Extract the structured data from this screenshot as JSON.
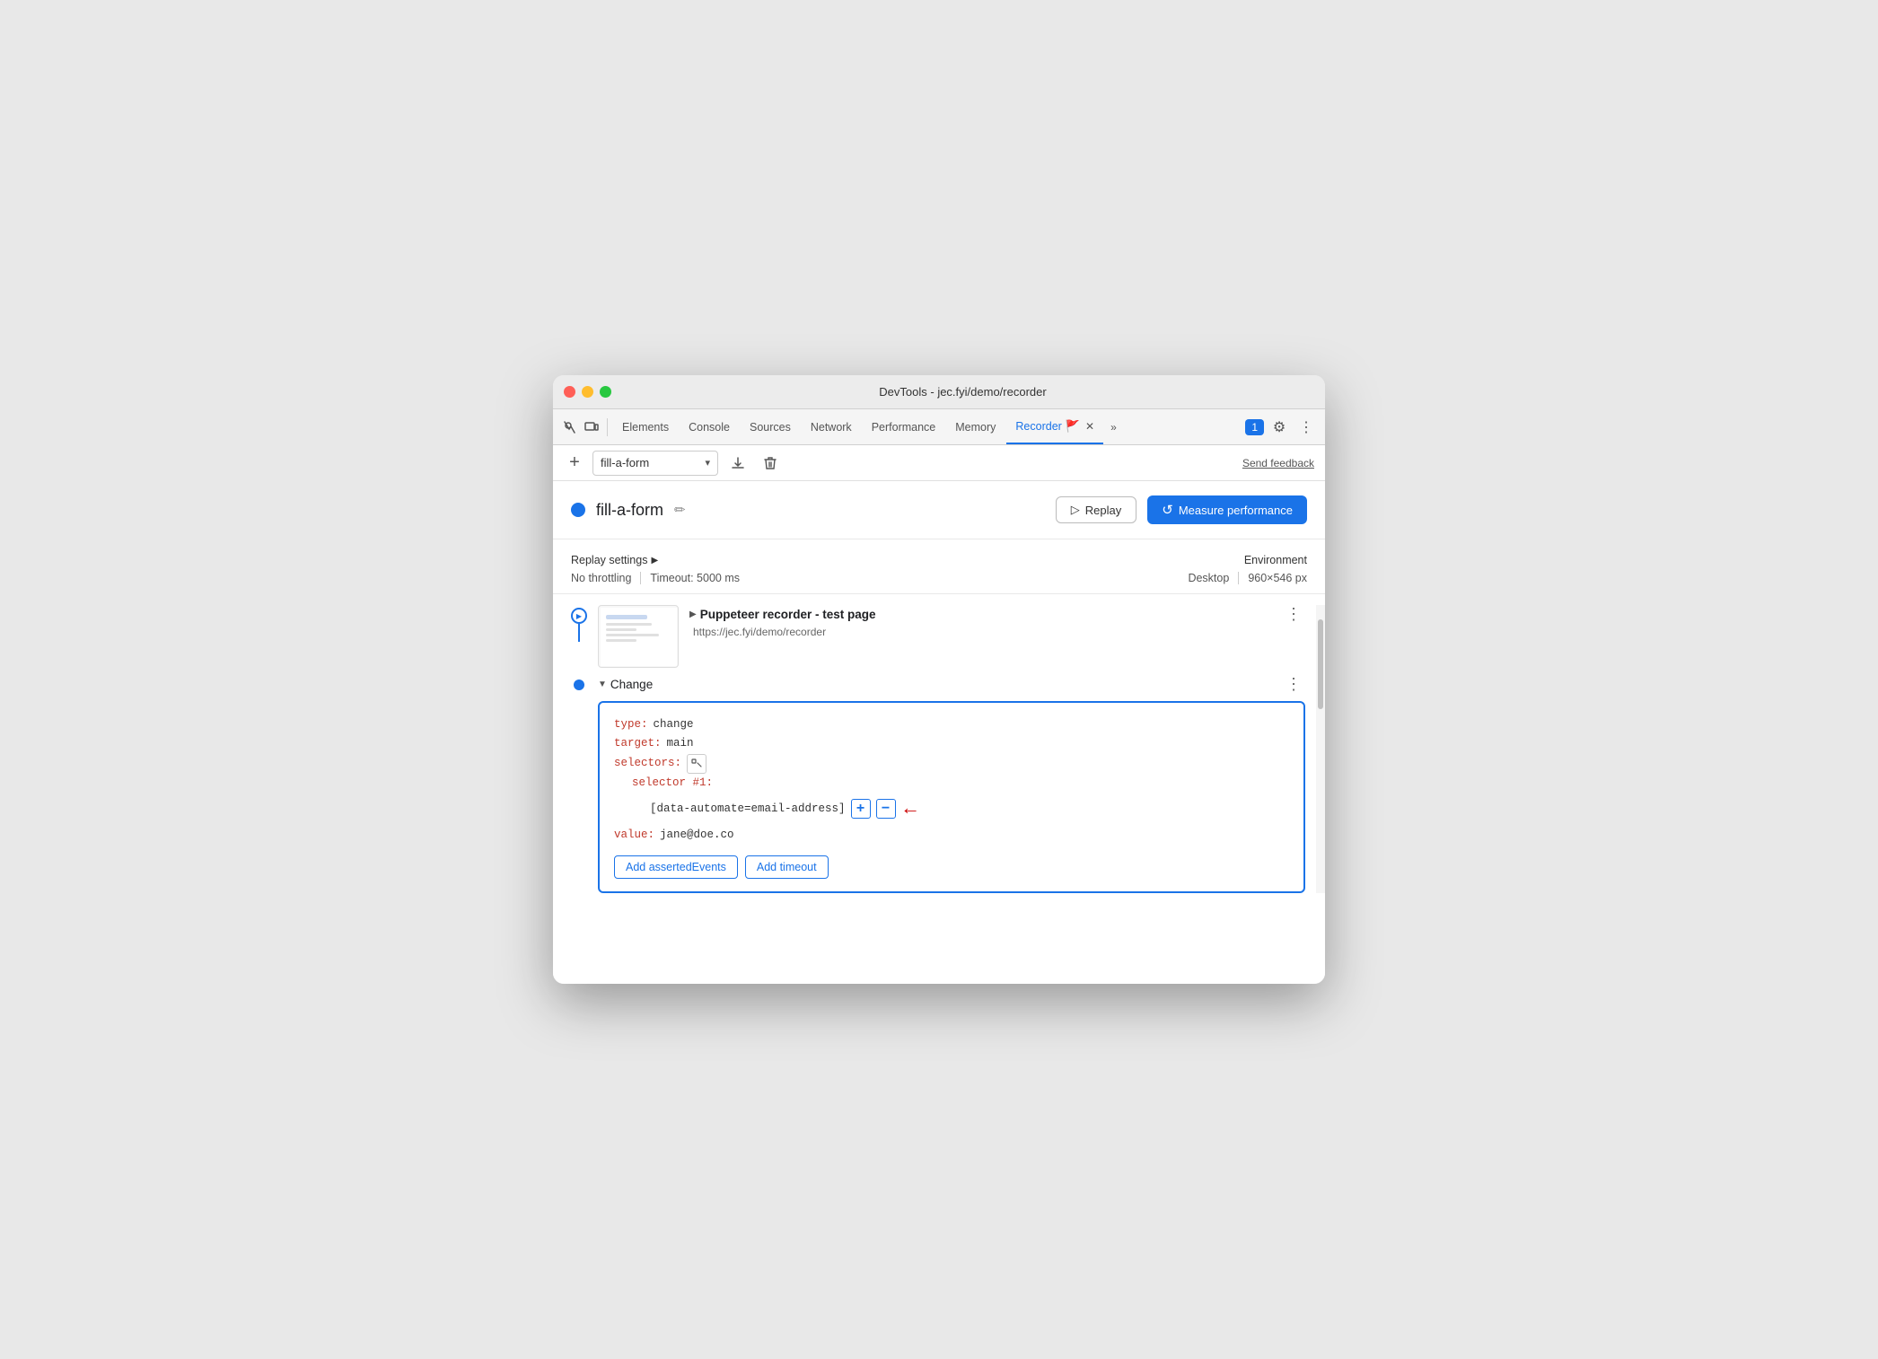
{
  "window": {
    "title": "DevTools - jec.fyi/demo/recorder"
  },
  "tabs": {
    "items": [
      {
        "label": "Elements",
        "active": false
      },
      {
        "label": "Console",
        "active": false
      },
      {
        "label": "Sources",
        "active": false
      },
      {
        "label": "Network",
        "active": false
      },
      {
        "label": "Performance",
        "active": false
      },
      {
        "label": "Memory",
        "active": false
      },
      {
        "label": "Recorder",
        "active": true
      }
    ],
    "more_label": "»",
    "chat_badge": "1",
    "recorder_close": "✕"
  },
  "toolbar": {
    "add_label": "+",
    "recording_name": "fill-a-form",
    "chevron": "▾",
    "send_feedback": "Send feedback"
  },
  "recording": {
    "title": "fill-a-form",
    "dot_color": "#1a73e8",
    "edit_icon": "✏",
    "replay_label": "Replay",
    "replay_icon": "▷",
    "measure_label": "Measure performance",
    "measure_icon": "↺"
  },
  "settings": {
    "replay_settings_label": "Replay settings",
    "triangle": "▶",
    "no_throttling": "No throttling",
    "timeout": "Timeout: 5000 ms",
    "environment_label": "Environment",
    "desktop": "Desktop",
    "resolution": "960×546 px"
  },
  "steps": {
    "step1": {
      "title": "Puppeteer recorder - test page",
      "url": "https://jec.fyi/demo/recorder",
      "triangle": "▶",
      "more": "⋮"
    },
    "step2": {
      "title": "Change",
      "triangle": "▼",
      "more": "⋮",
      "code": {
        "type_prop": "type:",
        "type_val": "change",
        "target_prop": "target:",
        "target_val": "main",
        "selectors_prop": "selectors:",
        "selector_num_prop": "selector #1:",
        "selector_val": "[data-automate=email-address]",
        "value_prop": "value:",
        "value_val": "jane@doe.co"
      },
      "add_asserted_label": "Add assertedEvents",
      "add_timeout_label": "Add timeout"
    }
  },
  "icons": {
    "cursor_pointer": "⬡",
    "expand_toggle": "⊞",
    "download": "⬇",
    "trash": "🗑",
    "settings_gear": "⚙",
    "kebab_menu": "⋮",
    "selector_picker": "⬡"
  }
}
